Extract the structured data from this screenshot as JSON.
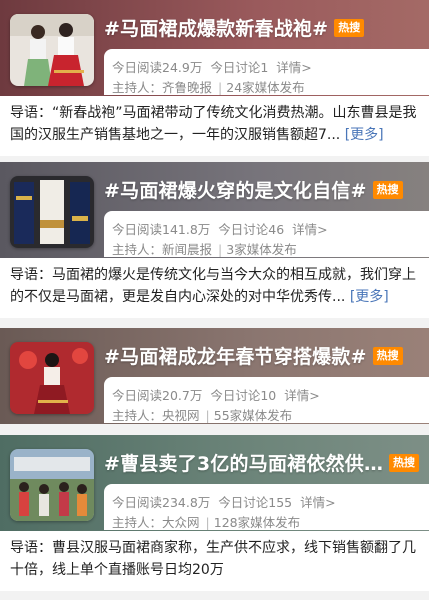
{
  "cards": [
    {
      "title": "#马面裙成爆款新春战袍#",
      "badge": "热搜",
      "reads": "今日阅读24.9万",
      "discuss": "今日讨论1",
      "details": "详情>",
      "host_label": "主持人：",
      "host": "齐鲁晚报",
      "media": "24家媒体发布",
      "desc": "导语：“新春战袍”马面裙带动了传统文化消费热潮。山东曹县是我国的汉服生产销售基地之一，一年的汉服销售额超7...",
      "more": "[更多]",
      "bg": "#8a4b4e"
    },
    {
      "title": "#马面裙爆火穿的是文化自信#",
      "badge": "热搜",
      "reads": "今日阅读141.8万",
      "discuss": "今日讨论46",
      "details": "详情>",
      "host_label": "主持人：",
      "host": "新闻晨报",
      "media": "3家媒体发布",
      "desc": "导语：马面裙的爆火是传统文化与当今大众的相互成就，我们穿上的不仅是马面裙，更是发自内心深处的对中华优秀传...",
      "more": "[更多]",
      "bg": "#6d6b72"
    },
    {
      "title": "#马面裙成龙年春节穿搭爆款#",
      "badge": "热搜",
      "reads": "今日阅读20.7万",
      "discuss": "今日讨论10",
      "details": "详情>",
      "host_label": "主持人：",
      "host": "央视网",
      "media": "55家媒体发布",
      "desc": "",
      "more": "",
      "bg": "#7b6a62"
    },
    {
      "title": "#曹县卖了3亿的马面裙依然供...",
      "badge": "热搜",
      "reads": "今日阅读234.8万",
      "discuss": "今日讨论155",
      "details": "详情>",
      "host_label": "主持人：",
      "host": "大众网",
      "media": "128家媒体发布",
      "desc": "导语：曹县汉服马面裙商家称，生产供不应求，线下销售额翻了几十倍，线上单个直播账号日均20万",
      "more": "",
      "bg": "#5f7d72"
    }
  ]
}
